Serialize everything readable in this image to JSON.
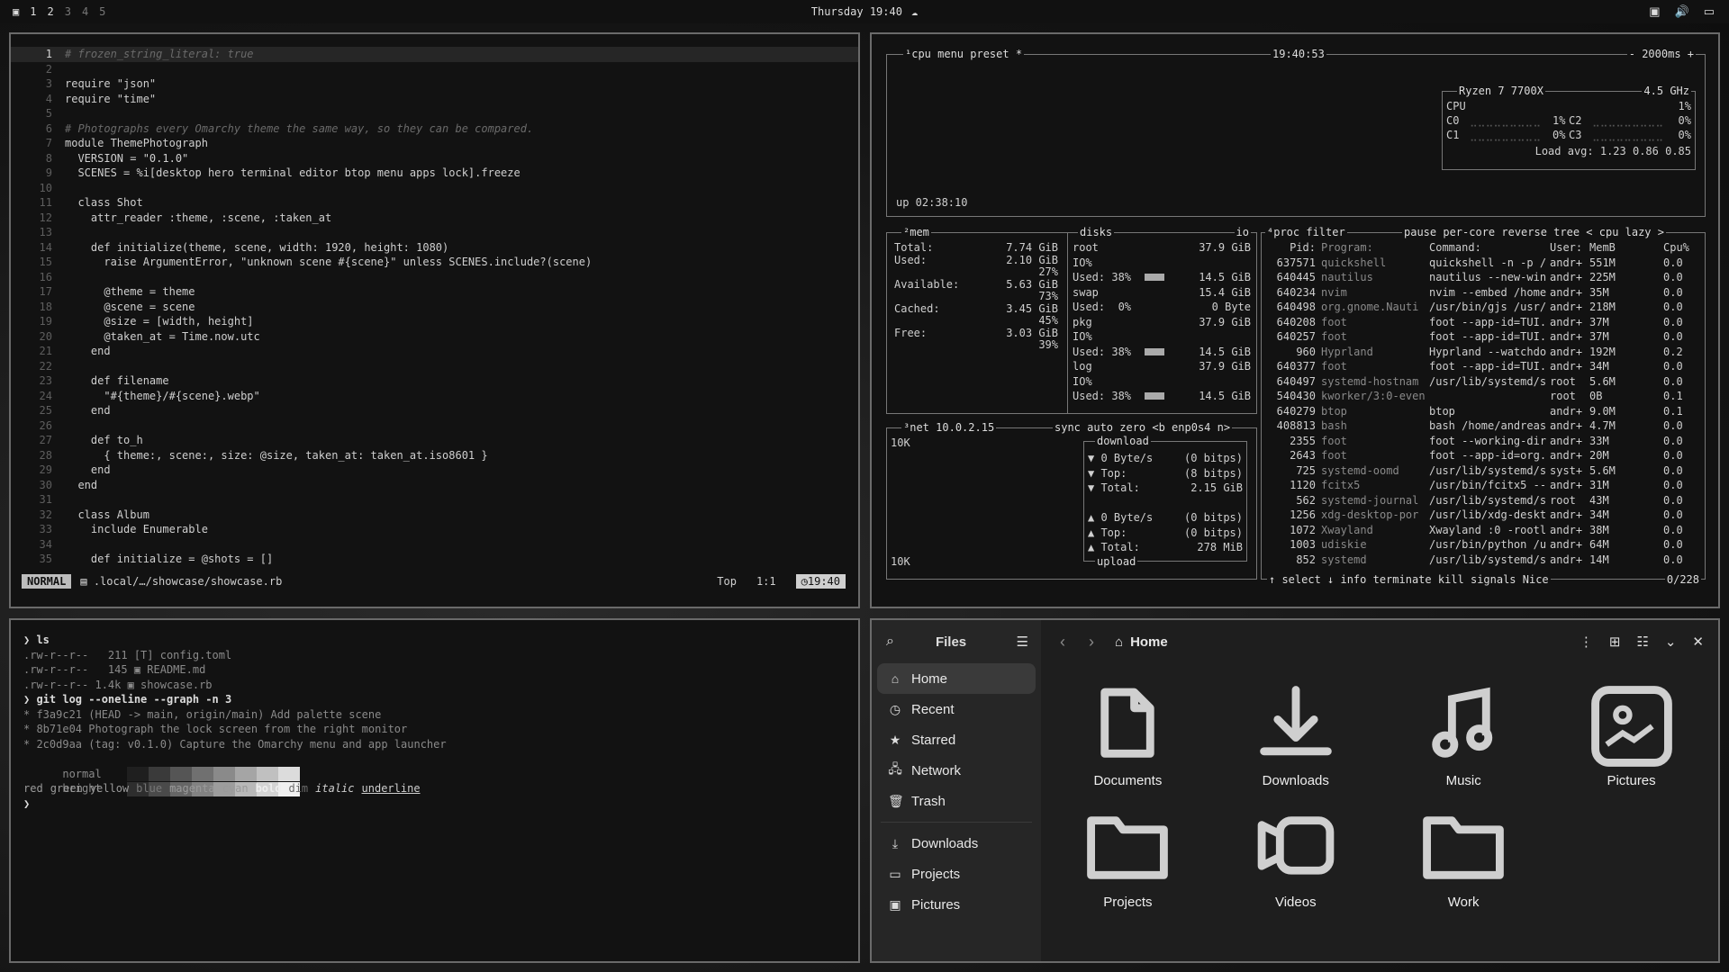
{
  "topbar": {
    "workspaces": [
      "1",
      "2",
      "3",
      "4",
      "5"
    ],
    "active_workspace": "1",
    "clock": "Thursday 19:40"
  },
  "editor": {
    "lines": [
      {
        "n": "1",
        "t": "# frozen_string_literal: true",
        "k": "cmt"
      },
      {
        "n": "2",
        "t": ""
      },
      {
        "n": "3",
        "t": "require \"json\""
      },
      {
        "n": "4",
        "t": "require \"time\""
      },
      {
        "n": "5",
        "t": ""
      },
      {
        "n": "6",
        "t": "# Photographs every Omarchy theme the same way, so they can be compared.",
        "k": "cmt"
      },
      {
        "n": "7",
        "t": "module ThemePhotograph"
      },
      {
        "n": "8",
        "t": "  VERSION = \"0.1.0\""
      },
      {
        "n": "9",
        "t": "  SCENES = %i[desktop hero terminal editor btop menu apps lock].freeze"
      },
      {
        "n": "10",
        "t": ""
      },
      {
        "n": "11",
        "t": "  class Shot"
      },
      {
        "n": "12",
        "t": "    attr_reader :theme, :scene, :taken_at"
      },
      {
        "n": "13",
        "t": ""
      },
      {
        "n": "14",
        "t": "    def initialize(theme, scene, width: 1920, height: 1080)"
      },
      {
        "n": "15",
        "t": "      raise ArgumentError, \"unknown scene #{scene}\" unless SCENES.include?(scene)"
      },
      {
        "n": "16",
        "t": ""
      },
      {
        "n": "17",
        "t": "      @theme = theme"
      },
      {
        "n": "18",
        "t": "      @scene = scene"
      },
      {
        "n": "19",
        "t": "      @size = [width, height]"
      },
      {
        "n": "20",
        "t": "      @taken_at = Time.now.utc"
      },
      {
        "n": "21",
        "t": "    end"
      },
      {
        "n": "22",
        "t": ""
      },
      {
        "n": "23",
        "t": "    def filename"
      },
      {
        "n": "24",
        "t": "      \"#{theme}/#{scene}.webp\""
      },
      {
        "n": "25",
        "t": "    end"
      },
      {
        "n": "26",
        "t": ""
      },
      {
        "n": "27",
        "t": "    def to_h"
      },
      {
        "n": "28",
        "t": "      { theme:, scene:, size: @size, taken_at: taken_at.iso8601 }"
      },
      {
        "n": "29",
        "t": "    end"
      },
      {
        "n": "30",
        "t": "  end"
      },
      {
        "n": "31",
        "t": ""
      },
      {
        "n": "32",
        "t": "  class Album"
      },
      {
        "n": "33",
        "t": "    include Enumerable"
      },
      {
        "n": "34",
        "t": ""
      },
      {
        "n": "35",
        "t": "    def initialize = @shots = []"
      }
    ],
    "status": {
      "mode": "NORMAL",
      "path": ".local/…/showcase/showcase.rb",
      "pos_top": "Top",
      "pos": "1:1",
      "time": "19:40"
    }
  },
  "btop": {
    "cpu": {
      "tabs": "¹cpu menu preset *",
      "clock": "19:40:53",
      "interval": "- 2000ms +",
      "model": "Ryzen 7 7700X",
      "freq": "4.5 GHz",
      "rows": [
        [
          "CPU",
          "",
          "1%"
        ],
        [
          "C0",
          "1%",
          "C2",
          "0%"
        ],
        [
          "C1",
          "0%",
          "C3",
          "0%"
        ]
      ],
      "load": "Load avg: 1.23 0.86 0.85",
      "uptime": "up 02:38:10"
    },
    "mem": {
      "title": "²mem",
      "rows": [
        [
          "Total:",
          "7.74 GiB"
        ],
        [
          "Used:",
          "2.10 GiB"
        ],
        [
          "",
          "27%"
        ],
        [
          "Available:",
          "5.63 GiB"
        ],
        [
          "",
          "73%"
        ],
        [
          "Cached:",
          "3.45 GiB"
        ],
        [
          "",
          "45%"
        ],
        [
          "Free:",
          "3.03 GiB"
        ],
        [
          "",
          "39%"
        ]
      ]
    },
    "disks": {
      "title": "disks",
      "io": "io",
      "rows": [
        [
          "root",
          "37.9 GiB"
        ],
        [
          "IO%",
          ""
        ],
        [
          "Used: 38%",
          "14.5 GiB"
        ],
        [
          "swap",
          "15.4 GiB"
        ],
        [
          "Used:  0%",
          "0 Byte"
        ],
        [
          "pkg",
          "37.9 GiB"
        ],
        [
          "IO%",
          ""
        ],
        [
          "Used: 38%",
          "14.5 GiB"
        ],
        [
          "log",
          "37.9 GiB"
        ],
        [
          "IO%",
          ""
        ],
        [
          "Used: 38%",
          "14.5 GiB"
        ]
      ]
    },
    "net": {
      "title": "³net",
      "ip": "10.0.2.15",
      "tabs": "sync auto zero <b enp0s4 n>",
      "scale_top": "10K",
      "scale_bottom": "10K",
      "download": "download",
      "upload": "upload",
      "rows": [
        [
          "▼ 0 Byte/s",
          "(0 bitps)"
        ],
        [
          "▼ Top:",
          "(8 bitps)"
        ],
        [
          "▼ Total:",
          "2.15 GiB"
        ],
        [
          "",
          ""
        ],
        [
          "▲ 0 Byte/s",
          "(0 bitps)"
        ],
        [
          "▲ Top:",
          "(0 bitps)"
        ],
        [
          "▲ Total:",
          "278 MiB"
        ]
      ]
    },
    "proc": {
      "title": "⁴proc filter",
      "tabs": "pause per-core reverse tree < cpu lazy >",
      "head": [
        "Pid:",
        "Program:",
        "Command:",
        "User:",
        "MemB",
        "Cpu%"
      ],
      "rows": [
        [
          "637571",
          "quickshell",
          "quickshell -n -p /",
          "andr+",
          "551M",
          "0.0"
        ],
        [
          "640445",
          "nautilus",
          "nautilus --new-win",
          "andr+",
          "225M",
          "0.0"
        ],
        [
          "640234",
          "nvim",
          "nvim --embed /home",
          "andr+",
          "35M",
          "0.0"
        ],
        [
          "640498",
          "org.gnome.Nauti",
          "/usr/bin/gjs /usr/",
          "andr+",
          "218M",
          "0.0"
        ],
        [
          "640208",
          "foot",
          "foot --app-id=TUI.",
          "andr+",
          "37M",
          "0.0"
        ],
        [
          "640257",
          "foot",
          "foot --app-id=TUI.",
          "andr+",
          "37M",
          "0.0"
        ],
        [
          "960",
          "Hyprland",
          "Hyprland --watchdo",
          "andr+",
          "192M",
          "0.2"
        ],
        [
          "640377",
          "foot",
          "foot --app-id=TUI.",
          "andr+",
          "34M",
          "0.0"
        ],
        [
          "640497",
          "systemd-hostnam",
          "/usr/lib/systemd/s",
          "root",
          "5.6M",
          "0.0"
        ],
        [
          "540430",
          "kworker/3:0-even",
          "",
          "root",
          "0B",
          "0.1"
        ],
        [
          "640279",
          "btop",
          "btop",
          "andr+",
          "9.0M",
          "0.1"
        ],
        [
          "408813",
          "bash",
          "bash /home/andreas",
          "andr+",
          "4.7M",
          "0.0"
        ],
        [
          "2355",
          "foot",
          "foot --working-dir",
          "andr+",
          "33M",
          "0.0"
        ],
        [
          "2643",
          "foot",
          "foot --app-id=org.",
          "andr+",
          "20M",
          "0.0"
        ],
        [
          "725",
          "systemd-oomd",
          "/usr/lib/systemd/s",
          "syst+",
          "5.6M",
          "0.0"
        ],
        [
          "1120",
          "fcitx5",
          "/usr/bin/fcitx5 --",
          "andr+",
          "31M",
          "0.0"
        ],
        [
          "562",
          "systemd-journal",
          "/usr/lib/systemd/s",
          "root",
          "43M",
          "0.0"
        ],
        [
          "1256",
          "xdg-desktop-por",
          "/usr/lib/xdg-deskt",
          "andr+",
          "34M",
          "0.0"
        ],
        [
          "1072",
          "Xwayland",
          "Xwayland :0 -rootl",
          "andr+",
          "38M",
          "0.0"
        ],
        [
          "1003",
          "udiskie",
          "/usr/bin/python /u",
          "andr+",
          "64M",
          "0.0"
        ],
        [
          "852",
          "systemd",
          "/usr/lib/systemd/s",
          "andr+",
          "14M",
          "0.0"
        ]
      ],
      "footer": "↑ select ↓ info terminate kill signals Nice",
      "count": "0/228"
    }
  },
  "terminal": {
    "lines": [
      {
        "p": "❯ ",
        "t": "ls",
        "k": "cmd"
      },
      {
        "t": ".rw-r--r--   211 [T] config.toml"
      },
      {
        "t": ".rw-r--r--   145 ▣ README.md"
      },
      {
        "t": ".rw-r--r-- 1.4k ▣ showcase.rb"
      },
      {
        "p": "❯ ",
        "t": "git log --oneline --graph -n 3",
        "k": "cmd"
      },
      {
        "t": "* f3a9c21 (HEAD -> main, origin/main) Add palette scene"
      },
      {
        "t": "* 8b71e04 Photograph the lock screen from the right monitor"
      },
      {
        "t": "* 2c0d9aa (tag: v0.1.0) Capture the Omarchy menu and app launcher"
      }
    ],
    "palette_normal": "normal",
    "palette_bright": "bright",
    "styles_line": [
      "red",
      "green",
      "yellow",
      "blue",
      "magenta",
      "cyan",
      "bold",
      "dim",
      "italic",
      "underline"
    ],
    "prompt_end": "❯"
  },
  "files": {
    "title": "Files",
    "location": "Home",
    "sidebar": [
      "Home",
      "Recent",
      "Starred",
      "Network",
      "Trash"
    ],
    "bookmarks": [
      "Downloads",
      "Projects",
      "Pictures"
    ],
    "items": [
      "Documents",
      "Downloads",
      "Music",
      "Pictures",
      "Projects",
      "Videos",
      "Work"
    ]
  }
}
